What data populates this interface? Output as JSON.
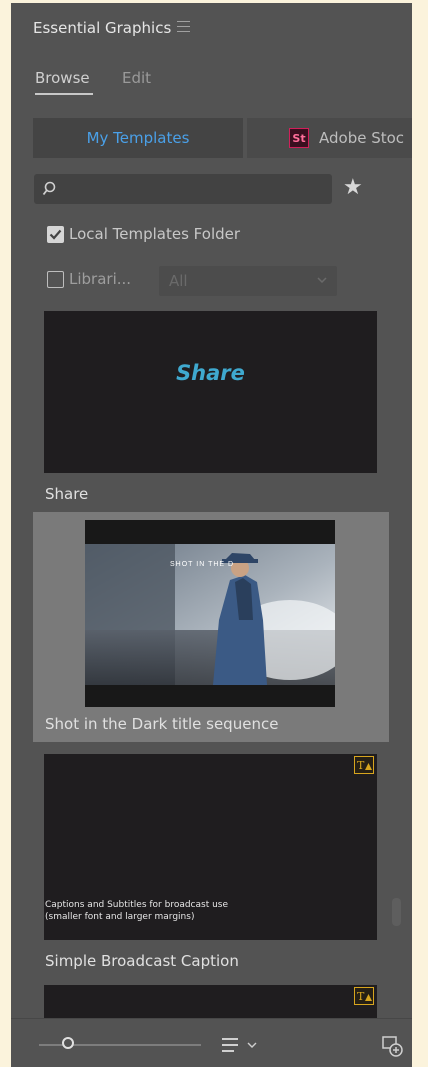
{
  "panel": {
    "title": "Essential Graphics",
    "menu_icon": "hamburger-menu-icon"
  },
  "tabs": [
    {
      "label": "Browse",
      "active": true
    },
    {
      "label": "Edit",
      "active": false
    }
  ],
  "sources": {
    "my_templates": "My Templates",
    "stock_badge": "St",
    "stock_label": "Adobe Stoc"
  },
  "search": {
    "value": "",
    "icon": "search-icon",
    "favorites_icon": "star-icon"
  },
  "filters": {
    "local_folder": {
      "label": "Local Templates Folder",
      "checked": true
    },
    "libraries": {
      "label": "Librari...",
      "checked": false
    },
    "libraries_dropdown": "All"
  },
  "templates": [
    {
      "name": "Share",
      "thumbnail_text": "Share"
    },
    {
      "name": "Shot in the Dark title sequence",
      "thumbnail_text": "SHOT IN THE D",
      "selected": true
    },
    {
      "name": "Simple Broadcast Caption",
      "thumbnail_text": "Captions and Subtitles for broadcast use\n(smaller font and larger margins)",
      "warning_icon": "missing-font-warning-icon"
    }
  ],
  "footer": {
    "zoom_slider_icon": "zoom-slider",
    "sort_icon": "sort-list-icon",
    "new_item_icon": "new-item-icon"
  },
  "colors": {
    "accent": "#4aa0e8",
    "share_text": "#3fa9cf",
    "warning": "#d7a51e",
    "panel_bg": "#535353"
  }
}
